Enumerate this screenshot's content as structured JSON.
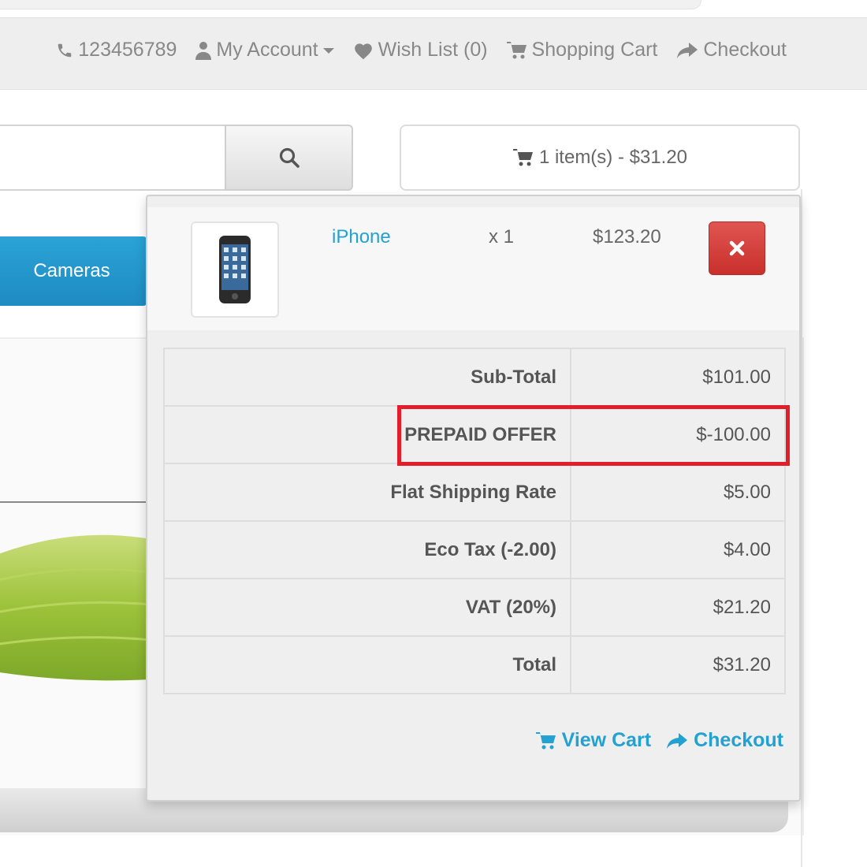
{
  "topnav": {
    "phone": "123456789",
    "account": "My Account",
    "wishlist": "Wish List (0)",
    "cart": "Shopping Cart",
    "checkout": "Checkout"
  },
  "cart_button": {
    "label": "1 item(s) - $31.20"
  },
  "menu": {
    "cameras": "Cameras"
  },
  "cart_item": {
    "name": "iPhone",
    "qty": "x 1",
    "price": "$123.20"
  },
  "totals": [
    {
      "label": "Sub-Total",
      "value": "$101.00"
    },
    {
      "label": "PREPAID OFFER",
      "value": "$-100.00"
    },
    {
      "label": "Flat Shipping Rate",
      "value": "$5.00"
    },
    {
      "label": "Eco Tax (-2.00)",
      "value": "$4.00"
    },
    {
      "label": "VAT (20%)",
      "value": "$21.20"
    },
    {
      "label": "Total",
      "value": "$31.20"
    }
  ],
  "footer": {
    "view_cart": "View Cart",
    "checkout": "Checkout"
  },
  "colors": {
    "accent": "#23a1d1",
    "danger": "#d9534f",
    "highlight": "#e31e2b"
  },
  "icons": [
    "phone-icon",
    "user-icon",
    "caret-down-icon",
    "heart-icon",
    "cart-icon",
    "share-icon",
    "search-icon",
    "remove-icon"
  ]
}
